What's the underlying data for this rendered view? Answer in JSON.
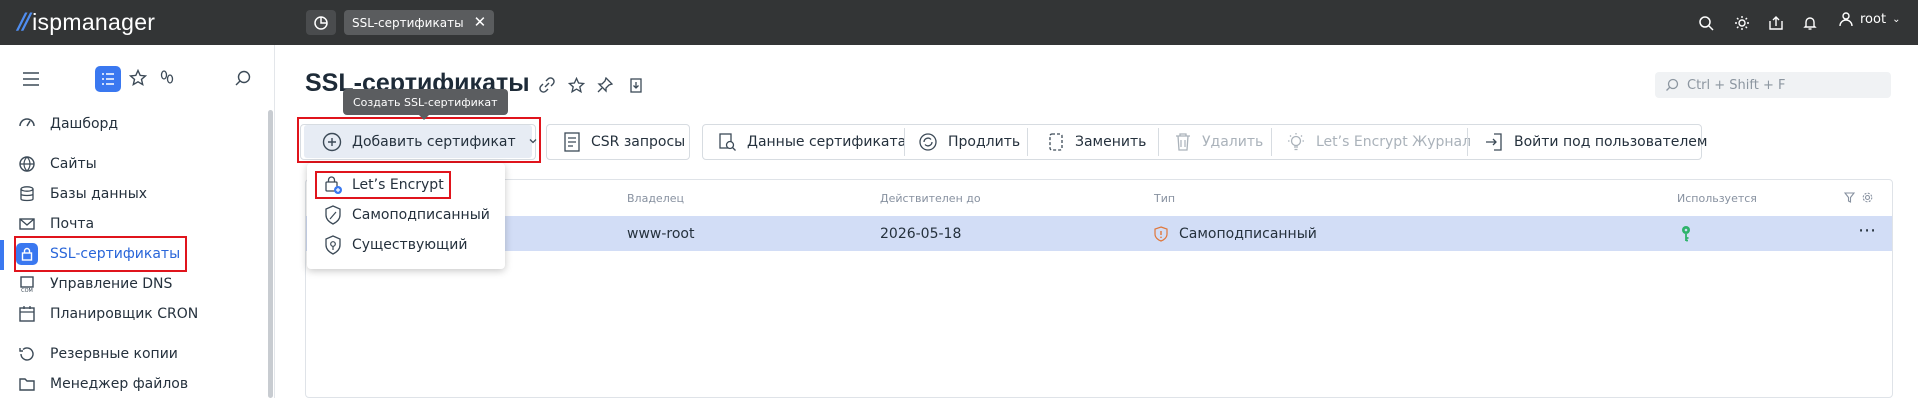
{
  "app": {
    "logo_text": "ispmanager"
  },
  "topbar": {
    "tab_label": "SSL-сертификаты",
    "user": "root"
  },
  "sidebar": {
    "items": [
      {
        "label": "Дашборд",
        "icon": "dashboard-icon"
      },
      {
        "label": "Сайты",
        "icon": "globe-icon"
      },
      {
        "label": "Базы данных",
        "icon": "database-icon"
      },
      {
        "label": "Почта",
        "icon": "mail-icon"
      },
      {
        "label": "SSL-сертификаты",
        "icon": "lock-icon",
        "active": true
      },
      {
        "label": "Управление DNS",
        "icon": "dns-icon"
      },
      {
        "label": "Планировщик CRON",
        "icon": "calendar-icon"
      },
      {
        "label": "Резервные копии",
        "icon": "backup-icon"
      },
      {
        "label": "Менеджер файлов",
        "icon": "folder-icon"
      }
    ]
  },
  "page": {
    "title": "SSL-сертификаты",
    "search_placeholder": "Ctrl + Shift + F",
    "tooltip": "Создать SSL-сертификат"
  },
  "toolbar": {
    "add": "Добавить сертификат",
    "csr": "CSR запросы",
    "data": "Данные сертификата",
    "renew": "Продлить",
    "replace": "Заменить",
    "delete": "Удалить",
    "le_log": "Let’s Encrypt Журнал",
    "login_as": "Войти под пользователем"
  },
  "dropdown": {
    "items": [
      "Let’s Encrypt",
      "Самоподписанный",
      "Существующий"
    ]
  },
  "table": {
    "columns": [
      "Владелец",
      "Действителен до",
      "Тип",
      "Используется"
    ],
    "rows": [
      {
        "owner": "www-root",
        "valid_until": "2026-05-18",
        "type": "Самоподписанный",
        "in_use": true
      }
    ]
  },
  "colors": {
    "accent": "#3a78f0",
    "highlight": "#e0141c",
    "topbar": "#333536",
    "selected_row": "#d2ddf6",
    "in_use": "#2fb36b"
  }
}
